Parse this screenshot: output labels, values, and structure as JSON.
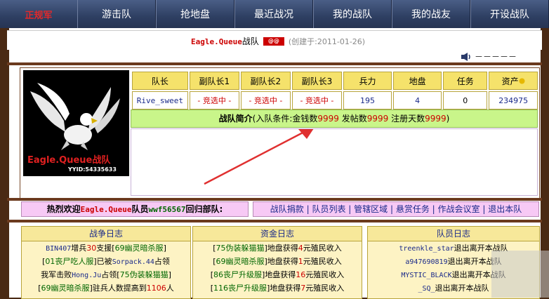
{
  "nav": {
    "logo": "正规军",
    "items": [
      "游击队",
      "抢地盘",
      "最近战况",
      "我的战队",
      "我的战友",
      "开设战队"
    ]
  },
  "header": {
    "team_name": "Eagle.Queue",
    "team_suffix": "战队",
    "emblem_text": "@@",
    "created": "(创建于:2011-01-26)"
  },
  "sound": {
    "icon": "speaker-icon",
    "dashes": "－－－－－"
  },
  "emblem": {
    "title": "Eagle.Queue战队",
    "yid": "YYID:54335633"
  },
  "info": {
    "headers": [
      "队长",
      "副队长1",
      "副队长2",
      "副队长3",
      "兵力",
      "地盘",
      "任务",
      "资产"
    ],
    "values": [
      "Rive_sweet",
      "- 竞选中 -",
      "- 竞选中 -",
      "- 竞选中 -",
      "195",
      "4",
      "0",
      "234975"
    ]
  },
  "intro": {
    "label": "战队简介",
    "cond_prefix": "(入队条件:金钱数",
    "money": "9999",
    "posts_label": " 发帖数",
    "posts": "9999",
    "days_label": " 注册天数",
    "days": "9999",
    "close": ")"
  },
  "welcome": {
    "prefix": "热烈欢迎",
    "team": "Eagle.Queue",
    "member_label": "队员",
    "member": "wwf56567",
    "suffix": "回归部队:"
  },
  "actions": [
    "战队捐款",
    "队员列表",
    "管辖区域",
    "悬赏任务",
    "作战会议室",
    "退出本队"
  ],
  "logs": {
    "war": {
      "title": "战争日志",
      "rows": [
        [
          "BIN407",
          "增兵",
          "30",
          "支援[",
          "69幽灵暗杀服",
          "]"
        ],
        [
          "[",
          "01丧尸吃人服",
          "]已被",
          "Sorpack.44",
          "占领",
          ""
        ],
        [
          "我军击败",
          "Hong.Ju",
          "占领[",
          "75伪装躲猫猫",
          "]",
          ""
        ],
        [
          "[",
          "69幽灵暗杀服",
          "]驻兵人数提高到",
          "1106",
          "人",
          ""
        ]
      ]
    },
    "funds": {
      "title": "资金日志",
      "rows": [
        [
          "[",
          "75伪装躲猫猫",
          "]地盘获得",
          "4",
          "元殖民收入"
        ],
        [
          "[",
          "69幽灵暗杀服",
          "]地盘获得",
          "1",
          "元殖民收入"
        ],
        [
          "[",
          "86丧尸升级服",
          "]地盘获得",
          "16",
          "元殖民收入"
        ],
        [
          "[",
          "116丧尸升级服",
          "]地盘获得",
          "7",
          "元殖民收入"
        ]
      ]
    },
    "members": {
      "title": "队员日志",
      "rows": [
        [
          "treenkle_star",
          "退出离开本战队"
        ],
        [
          "a947690819",
          "退出离开本战队"
        ],
        [
          "MYSTIC_BLACK",
          "退出离开本战队"
        ],
        [
          "_SQ_",
          "退出离开本战队"
        ]
      ]
    }
  }
}
